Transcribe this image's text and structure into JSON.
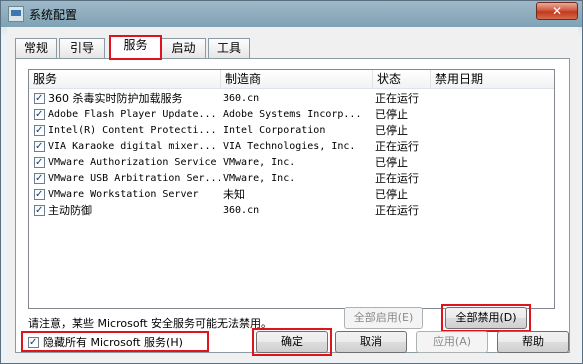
{
  "window": {
    "title": "系统配置",
    "close_label": "✕"
  },
  "tabs": [
    {
      "label": "常规"
    },
    {
      "label": "引导"
    },
    {
      "label": "服务"
    },
    {
      "label": "启动"
    },
    {
      "label": "工具"
    }
  ],
  "columns": {
    "service": "服务",
    "manufacturer": "制造商",
    "status": "状态",
    "disabled_date": "禁用日期"
  },
  "rows": [
    {
      "service": "360 杀毒实时防护加载服务",
      "manufacturer": "360.cn",
      "status": "正在运行",
      "checked": true
    },
    {
      "service": "Adobe Flash Player Update...",
      "manufacturer": "Adobe Systems Incorp...",
      "status": "已停止",
      "checked": true
    },
    {
      "service": "Intel(R) Content Protecti...",
      "manufacturer": "Intel Corporation",
      "status": "已停止",
      "checked": true
    },
    {
      "service": "VIA Karaoke digital mixer...",
      "manufacturer": "VIA Technologies, Inc.",
      "status": "正在运行",
      "checked": true
    },
    {
      "service": "VMware Authorization Service",
      "manufacturer": "VMware, Inc.",
      "status": "已停止",
      "checked": true
    },
    {
      "service": "VMware USB Arbitration Ser...",
      "manufacturer": "VMware, Inc.",
      "status": "正在运行",
      "checked": true
    },
    {
      "service": "VMware Workstation Server",
      "manufacturer": "未知",
      "status": "已停止",
      "checked": true
    },
    {
      "service": "主动防御",
      "manufacturer": "360.cn",
      "status": "正在运行",
      "checked": true
    }
  ],
  "note": "请注意，某些 Microsoft 安全服务可能无法禁用。",
  "buttons": {
    "enable_all": "全部启用(E)",
    "disable_all": "全部禁用(D)",
    "ok": "确定",
    "cancel": "取消",
    "apply": "应用(A)",
    "help": "帮助"
  },
  "hide_ms": {
    "label": "隐藏所有 Microsoft 服务(H)",
    "checked": true
  },
  "accent_colors": {
    "highlight_red": "#e0131a"
  }
}
